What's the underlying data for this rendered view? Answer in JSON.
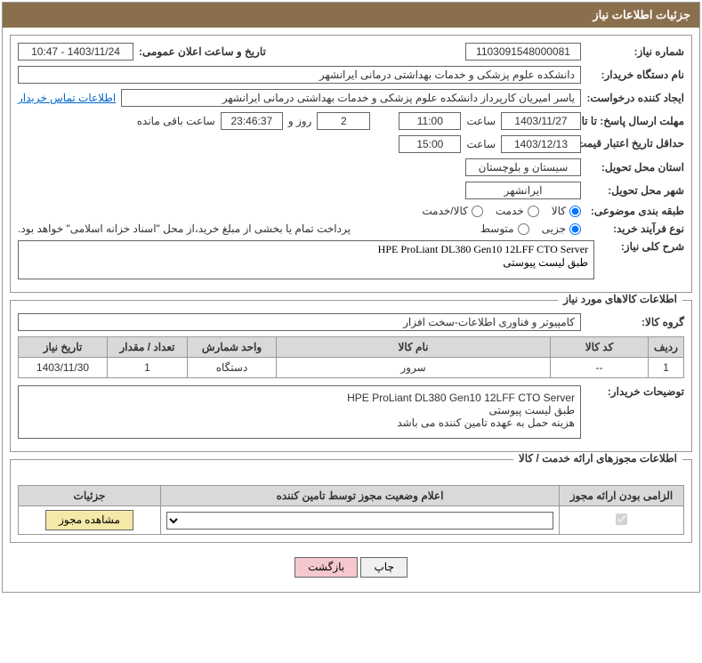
{
  "header": {
    "title": "جزئیات اطلاعات نیاز"
  },
  "req": {
    "number_label": "شماره نیاز:",
    "number": "1103091548000081",
    "announce_label": "تاریخ و ساعت اعلان عمومی:",
    "announce": "1403/11/24 - 10:47",
    "buyer_label": "نام دستگاه خریدار:",
    "buyer": "دانشکده علوم پزشکی و خدمات بهداشتی درمانی ایرانشهر",
    "creator_label": "ایجاد کننده درخواست:",
    "creator": "یاسر امیریان کارپرداز دانشکده علوم پزشکی و خدمات بهداشتی درمانی ایرانشهر",
    "contact_link": "اطلاعات تماس خریدار",
    "deadline_reply_label": "مهلت ارسال پاسخ: تا تاریخ:",
    "deadline_reply_date": "1403/11/27",
    "time_label": "ساعت",
    "deadline_reply_time": "11:00",
    "days": "2",
    "days_and": "روز و",
    "countdown": "23:46:37",
    "remaining_label": "ساعت باقی مانده",
    "validity_label": "حداقل تاریخ اعتبار قیمت: تا تاریخ:",
    "validity_date": "1403/12/13",
    "validity_time": "15:00",
    "province_label": "استان محل تحویل:",
    "province": "سیستان و بلوچستان",
    "city_label": "شهر محل تحویل:",
    "city": "ایرانشهر",
    "category_label": "طبقه بندی موضوعی:",
    "cat_goods": "کالا",
    "cat_service": "خدمت",
    "cat_both": "کالا/خدمت",
    "purchase_type_label": "نوع فرآیند خرید:",
    "pt_minor": "جزیی",
    "pt_medium": "متوسط",
    "payment_note": "پرداخت تمام یا بخشی از مبلغ خرید،از محل \"اسناد خزانه اسلامی\" خواهد بود.",
    "desc_label": "شرح کلی نیاز:",
    "desc": "HPE ProLiant DL380 Gen10 12LFF CTO Server\nطبق لیست پیوستی"
  },
  "goods_section": {
    "title": "اطلاعات کالاهای مورد نیاز",
    "group_label": "گروه کالا:",
    "group": "کامپیوتر و فناوری اطلاعات-سخت افزار",
    "headers": {
      "row": "ردیف",
      "code": "کد کالا",
      "name": "نام کالا",
      "unit": "واحد شمارش",
      "qty": "تعداد / مقدار",
      "date": "تاریخ نیاز"
    },
    "rows": [
      {
        "row": "1",
        "code": "--",
        "name": "سرور",
        "unit": "دستگاه",
        "qty": "1",
        "date": "1403/11/30"
      }
    ],
    "buyer_notes_label": "توضیحات خریدار:",
    "buyer_notes": "HPE ProLiant DL380 Gen10 12LFF CTO Server\nطبق لیست پیوستی\nهزینه حمل به عهده تامین کننده می باشد"
  },
  "permits": {
    "title": "اطلاعات مجوزهای ارائه خدمت / کالا",
    "headers": {
      "mandatory": "الزامی بودن ارائه مجوز",
      "status": "اعلام وضعیت مجوز توسط تامین کننده",
      "details": "جزئیات"
    },
    "view_btn": "مشاهده مجوز"
  },
  "footer": {
    "print": "چاپ",
    "back": "بازگشت"
  }
}
